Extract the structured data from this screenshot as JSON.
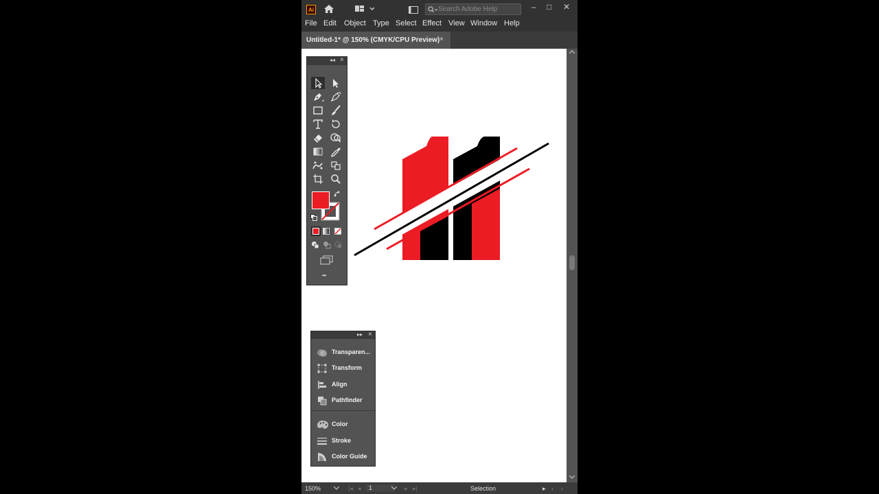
{
  "app": {
    "logo": "Ai",
    "search_placeholder": "Search Adobe Help",
    "window_controls": [
      "–",
      "□",
      "✕"
    ]
  },
  "menu": {
    "items": [
      "File",
      "Edit",
      "Object",
      "Type",
      "Select",
      "Effect",
      "View",
      "Window",
      "Help"
    ]
  },
  "document_tab": {
    "title": "Untitled-1* @ 150% (CMYK/CPU Preview)",
    "close": "×"
  },
  "tools_panel": {
    "collapse": "◂◂",
    "close": "×",
    "more": "•••",
    "fill_color": "#ec1c24",
    "stroke": "none"
  },
  "properties_panel": {
    "collapse": "▸▸",
    "close": "×",
    "items": [
      {
        "label": "Transparen...",
        "icon": "transparency-icon"
      },
      {
        "label": "Transform",
        "icon": "transform-icon"
      },
      {
        "label": "Align",
        "icon": "align-icon"
      },
      {
        "label": "Pathfinder",
        "icon": "pathfinder-icon"
      },
      {
        "label": "Color",
        "icon": "color-palette-icon"
      },
      {
        "label": "Stroke",
        "icon": "stroke-icon"
      },
      {
        "label": "Color Guide",
        "icon": "color-guide-icon"
      }
    ]
  },
  "artwork": {
    "red": "#ec1c24",
    "black": "#000000"
  },
  "status": {
    "zoom": "150%",
    "artboard": "1",
    "tool": "Selection"
  }
}
